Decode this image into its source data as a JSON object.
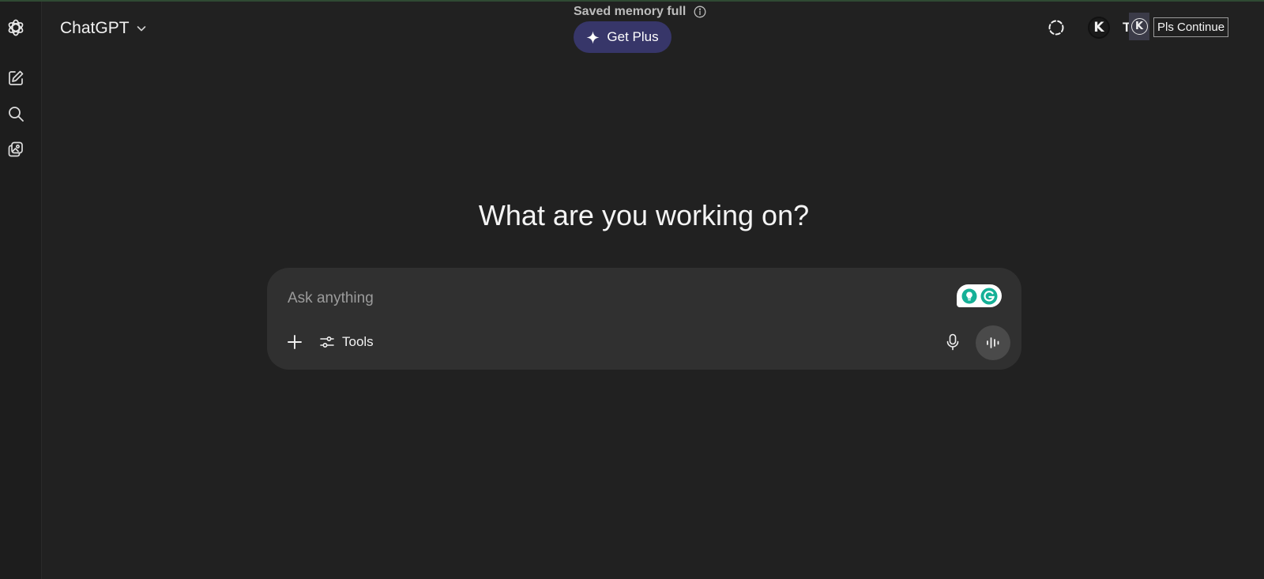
{
  "app": {
    "model_name": "ChatGPT"
  },
  "header": {
    "memory_notice": "Saved memory full",
    "upgrade_label": "Get Plus",
    "avatar_initial": "K",
    "overlap_letter": "T",
    "extension_initial": "K",
    "extension_tooltip": "Pls Continue"
  },
  "main": {
    "headline": "What are you working on?"
  },
  "composer": {
    "placeholder": "Ask anything",
    "value": "",
    "tools_label": "Tools"
  },
  "colors": {
    "background": "#212121",
    "sidebar": "#1d1d1d",
    "composer": "#303030",
    "get_plus": "#373669",
    "grammarly_green": "#15b097"
  },
  "icons": {
    "sidebar": [
      "openai-logo-icon",
      "new-chat-icon",
      "search-icon",
      "library-icon"
    ],
    "header": [
      "chevron-down-icon",
      "sparkle-icon",
      "info-icon",
      "temporary-chat-icon"
    ],
    "composer": [
      "plus-icon",
      "tools-sliders-icon",
      "microphone-icon",
      "voice-waveform-icon",
      "grammarly-icon"
    ]
  }
}
